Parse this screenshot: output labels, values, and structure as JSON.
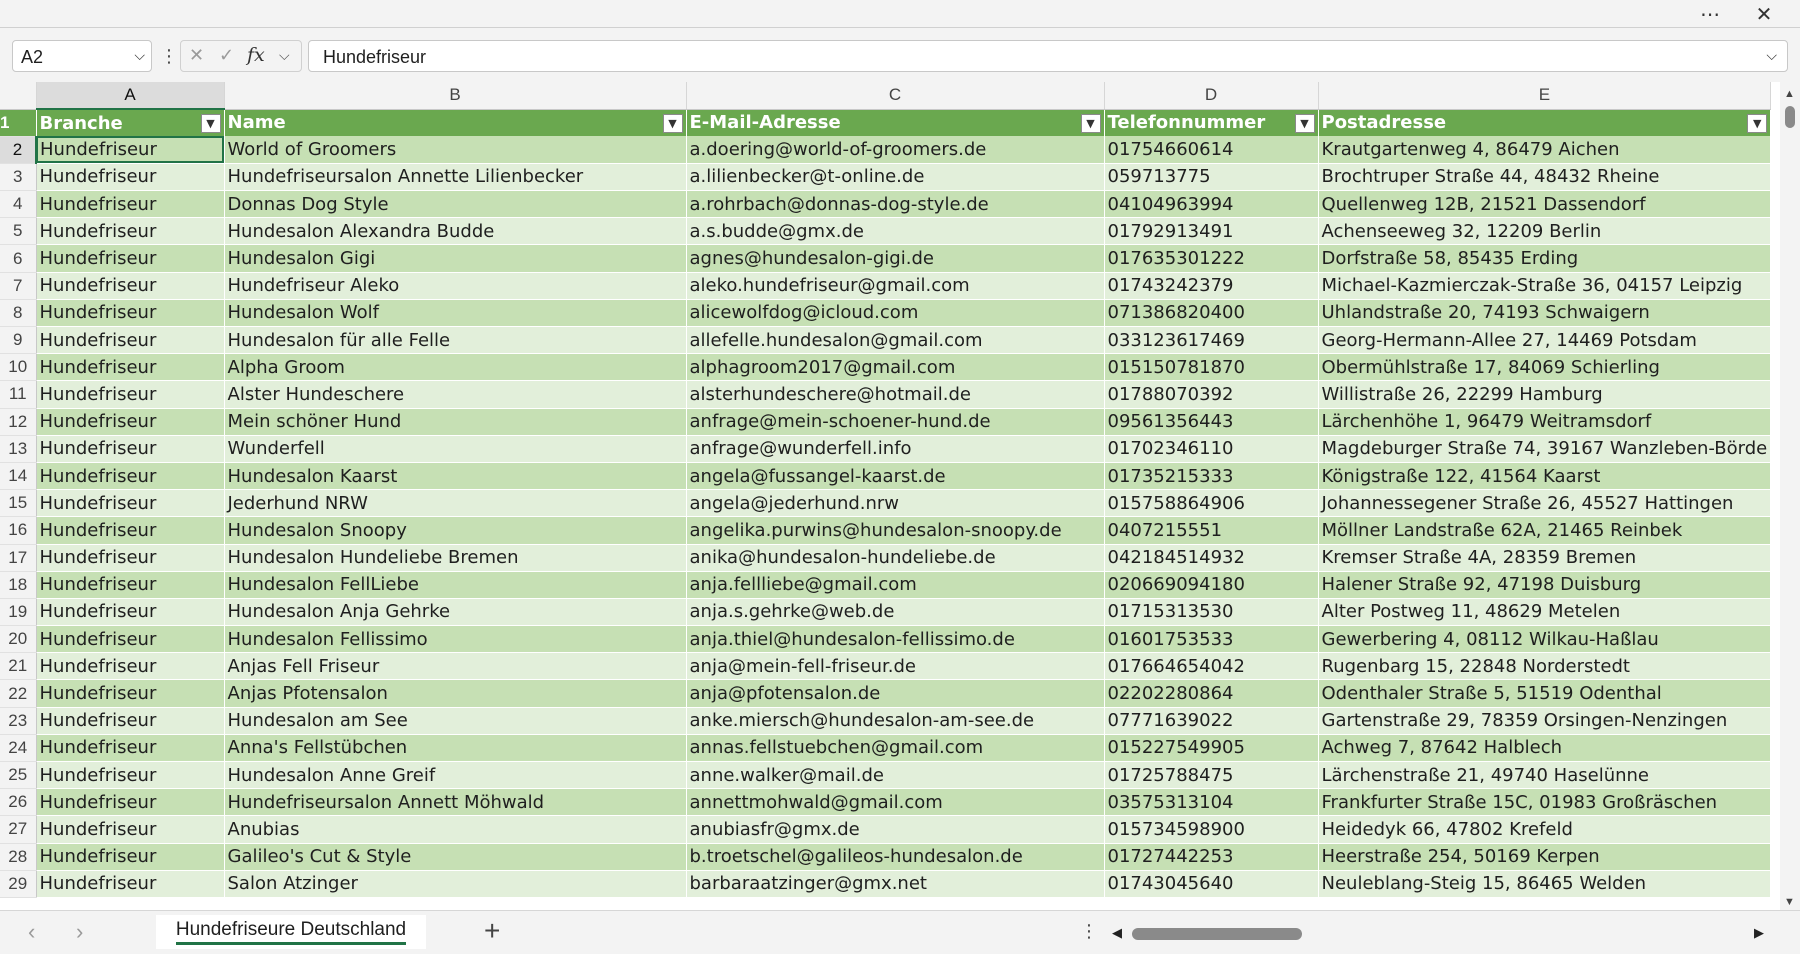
{
  "window": {
    "more_icon": "more-horizontal-icon",
    "close_icon": "close-icon"
  },
  "formula_bar": {
    "name_box": "A2",
    "formula_value": "Hundefriseur",
    "fx_label": "fx"
  },
  "columns": [
    "A",
    "B",
    "C",
    "D",
    "E"
  ],
  "selected_column": "A",
  "selected_row": 2,
  "table": {
    "headers": [
      "Branche",
      "Name",
      "E-Mail-Adresse",
      "Telefonnummer",
      "Postadresse"
    ],
    "rows": [
      [
        "Hundefriseur",
        "World of Groomers",
        "a.doering@world-of-groomers.de",
        "01754660614",
        "Krautgartenweg 4, 86479 Aichen"
      ],
      [
        "Hundefriseur",
        "Hundefriseursalon Annette Lilienbecker",
        "a.lilienbecker@t-online.de",
        "059713775",
        "Brochtruper Straße 44, 48432 Rheine"
      ],
      [
        "Hundefriseur",
        "Donnas Dog Style",
        "a.rohrbach@donnas-dog-style.de",
        "04104963994",
        "Quellenweg 12B, 21521 Dassendorf"
      ],
      [
        "Hundefriseur",
        "Hundesalon Alexandra Budde",
        "a.s.budde@gmx.de",
        "01792913491",
        "Achenseeweg 32, 12209 Berlin"
      ],
      [
        "Hundefriseur",
        "Hundesalon Gigi",
        "agnes@hundesalon-gigi.de",
        "017635301222",
        "Dorfstraße 58, 85435 Erding"
      ],
      [
        "Hundefriseur",
        "Hundefriseur Aleko",
        "aleko.hundefriseur@gmail.com",
        "01743242379",
        "Michael-Kazmierczak-Straße 36, 04157 Leipzig"
      ],
      [
        "Hundefriseur",
        "Hundesalon Wolf",
        "alicewolfdog@icloud.com",
        "071386820400",
        "Uhlandstraße 20, 74193 Schwaigern"
      ],
      [
        "Hundefriseur",
        "Hundesalon für alle Felle",
        "allefelle.hundesalon@gmail.com",
        "033123617469",
        "Georg-Hermann-Allee 27, 14469 Potsdam"
      ],
      [
        "Hundefriseur",
        "Alpha Groom",
        "alphagroom2017@gmail.com",
        "015150781870",
        "Obermühlstraße 17, 84069 Schierling"
      ],
      [
        "Hundefriseur",
        "Alster Hundeschere",
        "alsterhundeschere@hotmail.de",
        "01788070392",
        "Willistraße 26, 22299 Hamburg"
      ],
      [
        "Hundefriseur",
        "Mein schöner Hund",
        "anfrage@mein-schoener-hund.de",
        "09561356443",
        "Lärchenhöhe 1, 96479 Weitramsdorf"
      ],
      [
        "Hundefriseur",
        "Wunderfell",
        "anfrage@wunderfell.info",
        "01702346110",
        "Magdeburger Straße 74, 39167 Wanzleben-Börde"
      ],
      [
        "Hundefriseur",
        "Hundesalon Kaarst",
        "angela@fussangel-kaarst.de",
        "01735215333",
        "Königstraße 122, 41564 Kaarst"
      ],
      [
        "Hundefriseur",
        "Jederhund NRW",
        "angela@jederhund.nrw",
        "015758864906",
        "Johannessegener Straße 26, 45527 Hattingen"
      ],
      [
        "Hundefriseur",
        "Hundesalon Snoopy",
        "angelika.purwins@hundesalon-snoopy.de",
        "0407215551",
        "Möllner Landstraße 62A, 21465 Reinbek"
      ],
      [
        "Hundefriseur",
        "Hundesalon Hundeliebe Bremen",
        "anika@hundesalon-hundeliebe.de",
        "042184514932",
        "Kremser Straße 4A, 28359 Bremen"
      ],
      [
        "Hundefriseur",
        "Hundesalon FellLiebe",
        "anja.fellliebe@gmail.com",
        "020669094180",
        "Halener Straße 92, 47198 Duisburg"
      ],
      [
        "Hundefriseur",
        "Hundesalon Anja Gehrke",
        "anja.s.gehrke@web.de",
        "01715313530",
        "Alter Postweg 11, 48629 Metelen"
      ],
      [
        "Hundefriseur",
        "Hundesalon Fellissimo",
        "anja.thiel@hundesalon-fellissimo.de",
        "01601753533",
        "Gewerbering 4, 08112 Wilkau-Haßlau"
      ],
      [
        "Hundefriseur",
        "Anjas Fell Friseur",
        "anja@mein-fell-friseur.de",
        "017664654042",
        "Rugenbarg 15, 22848 Norderstedt"
      ],
      [
        "Hundefriseur",
        "Anjas Pfotensalon",
        "anja@pfotensalon.de",
        "02202280864",
        "Odenthaler Straße 5, 51519 Odenthal"
      ],
      [
        "Hundefriseur",
        "Hundesalon am See",
        "anke.miersch@hundesalon-am-see.de",
        "07771639022",
        "Gartenstraße 29, 78359 Orsingen-Nenzingen"
      ],
      [
        "Hundefriseur",
        "Anna's Fellstübchen",
        "annas.fellstuebchen@gmail.com",
        "015227549905",
        "Achweg 7, 87642 Halblech"
      ],
      [
        "Hundefriseur",
        "Hundesalon Anne Greif",
        "anne.walker@mail.de",
        "01725788475",
        "Lärchenstraße 21, 49740 Haselünne"
      ],
      [
        "Hundefriseur",
        "Hundefriseursalon Annett Möhwald",
        "annettmohwald@gmail.com",
        "03575313104",
        "Frankfurter Straße 15C, 01983 Großräschen"
      ],
      [
        "Hundefriseur",
        "Anubias",
        "anubiasfr@gmx.de",
        "015734598900",
        "Heidedyk 66, 47802 Krefeld"
      ],
      [
        "Hundefriseur",
        "Galileo's Cut & Style",
        "b.troetschel@galileos-hundesalon.de",
        "01727442253",
        "Heerstraße 254, 50169 Kerpen"
      ],
      [
        "Hundefriseur",
        "Salon Atzinger",
        "barbaraatzinger@gmx.net",
        "01743045640",
        "Neuleblang-Steig 15, 86465 Welden"
      ]
    ]
  },
  "sheet_tabs": [
    {
      "label": "Hundefriseure Deutschland",
      "active": true
    }
  ],
  "icons": {
    "prev_sheet": "chevron-left-icon",
    "next_sheet": "chevron-right-icon",
    "add_sheet": "plus-icon"
  },
  "colors": {
    "header_bg": "#6aa84f",
    "band_dark": "#c6e0b4",
    "band_light": "#e2efda",
    "accent": "#217346"
  }
}
